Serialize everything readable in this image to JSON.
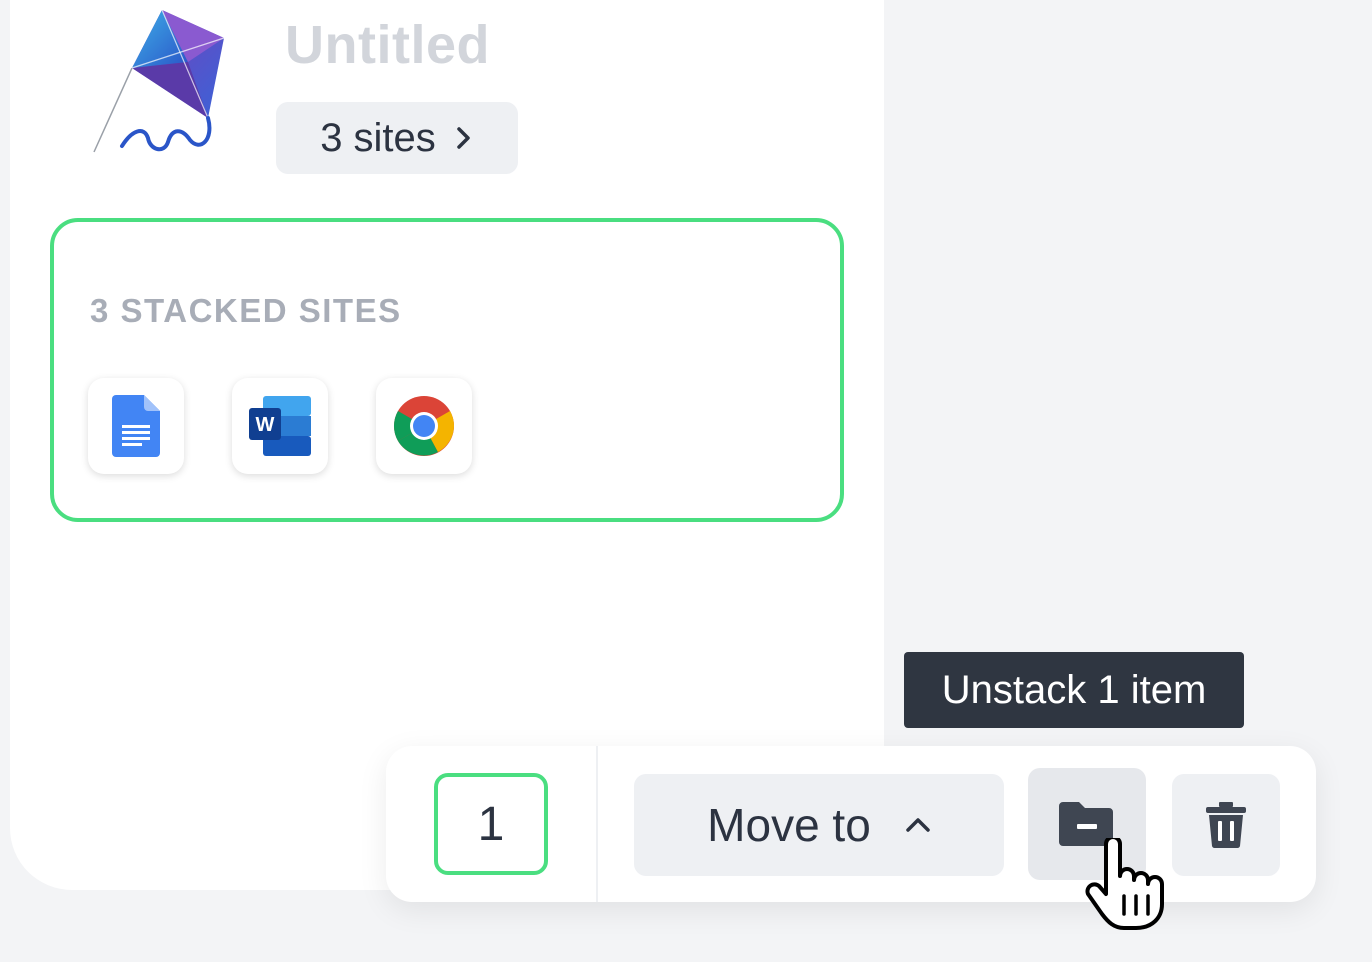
{
  "header": {
    "title": "Untitled",
    "sites_button_label": "3 sites"
  },
  "stack": {
    "label": "3 STACKED SITES",
    "sites": [
      {
        "icon": "google-docs-icon"
      },
      {
        "icon": "microsoft-word-icon"
      },
      {
        "icon": "chrome-icon"
      }
    ]
  },
  "tooltip": {
    "text": "Unstack 1 item"
  },
  "action_bar": {
    "selected_count": "1",
    "move_to_label": "Move to"
  },
  "colors": {
    "accent_green": "#4ade80",
    "dark_text": "#2c3341",
    "tooltip_bg": "#2f3641"
  }
}
